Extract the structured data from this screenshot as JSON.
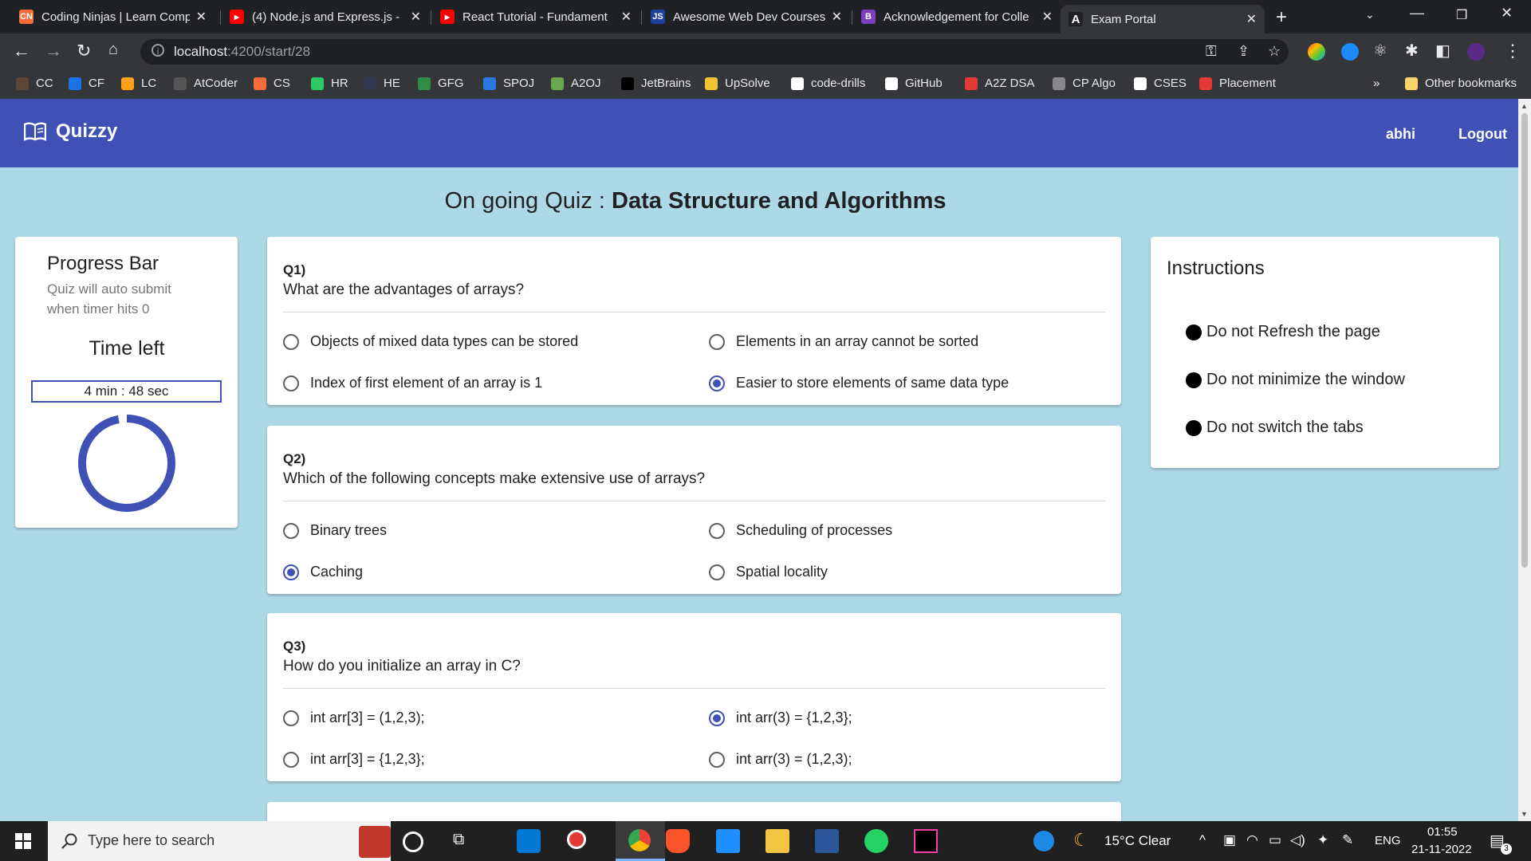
{
  "browser": {
    "tabs": [
      {
        "title": "Coding Ninjas | Learn Comp",
        "fav_text": "CN",
        "fav_color": "#f66c3b"
      },
      {
        "title": "(4) Node.js and Express.js -",
        "fav_text": "▶",
        "fav_color": "#ff0000"
      },
      {
        "title": "React Tutorial - Fundament",
        "fav_text": "▶",
        "fav_color": "#ff0000"
      },
      {
        "title": "Awesome Web Dev Courses",
        "fav_text": "JS",
        "fav_color": "#1f3f9f"
      },
      {
        "title": "Acknowledgement for Colle",
        "fav_text": "B",
        "fav_color": "#7b3fbf"
      },
      {
        "title": "Exam Portal",
        "fav_text": "A",
        "fav_color": "#202124"
      }
    ],
    "url_host": "localhost",
    "url_path": ":4200/start/28",
    "bookmarks": [
      {
        "label": "CC",
        "color": "#5b4638"
      },
      {
        "label": "CF",
        "color": "#1a73e8"
      },
      {
        "label": "LC",
        "color": "#ffa116"
      },
      {
        "label": "AtCoder",
        "color": "#555555"
      },
      {
        "label": "CS",
        "color": "#f66c3b"
      },
      {
        "label": "HR",
        "color": "#2ec866"
      },
      {
        "label": "HE",
        "color": "#323754"
      },
      {
        "label": "GFG",
        "color": "#2f8d46"
      },
      {
        "label": "SPOJ",
        "color": "#2b78e4"
      },
      {
        "label": "A2OJ",
        "color": "#6aa84f"
      },
      {
        "label": "JetBrains",
        "color": "#000000"
      },
      {
        "label": "UpSolve",
        "color": "#f1c232"
      },
      {
        "label": "code-drills",
        "color": "#ffffff"
      },
      {
        "label": "GitHub",
        "color": "#ffffff"
      },
      {
        "label": "A2Z DSA",
        "color": "#e53935"
      },
      {
        "label": "CP Algo",
        "color": "#888888"
      },
      {
        "label": "CSES",
        "color": "#ffffff"
      },
      {
        "label": "Placement",
        "color": "#e53935"
      }
    ],
    "more_bookmarks": "»",
    "other_bookmarks": "Other bookmarks"
  },
  "app": {
    "brand": "Quizzy",
    "user": "abhi",
    "logout": "Logout",
    "title_prefix": "On going Quiz : ",
    "quiz_title": "Data Structure and Algorithms",
    "accent": "#3f51b5",
    "background": "#add8e6"
  },
  "progress": {
    "title": "Progress Bar",
    "subtitle": "Quiz will auto submit when timer hits 0",
    "time_label": "Time left",
    "timer": "4 min : 48 sec",
    "fraction_remaining": 0.97
  },
  "questions": [
    {
      "number": "Q1)",
      "text": "What are the advantages of arrays?",
      "options": [
        "Objects of mixed data types can be stored",
        "Elements in an array cannot be sorted",
        "Index of first element of an array is 1",
        "Easier to store elements of same data type"
      ],
      "selected": 3
    },
    {
      "number": "Q2)",
      "text": "Which of the following concepts make extensive use of arrays?",
      "options": [
        "Binary trees",
        "Scheduling of processes",
        "Caching",
        "Spatial locality"
      ],
      "selected": 2
    },
    {
      "number": "Q3)",
      "text": "How do you initialize an array in C?",
      "options": [
        "int arr[3] = (1,2,3);",
        "int arr(3) = {1,2,3};",
        "int arr[3] = {1,2,3};",
        "int arr(3) = (1,2,3);"
      ],
      "selected": 1
    }
  ],
  "instructions": {
    "title": "Instructions",
    "items": [
      "Do not Refresh the page",
      "Do not minimize the window",
      "Do not switch the tabs"
    ]
  },
  "taskbar": {
    "search_placeholder": "Type here to search",
    "weather": "15°C  Clear",
    "language": "ENG",
    "time": "01:55",
    "date": "21-11-2022",
    "notifications": "3"
  }
}
